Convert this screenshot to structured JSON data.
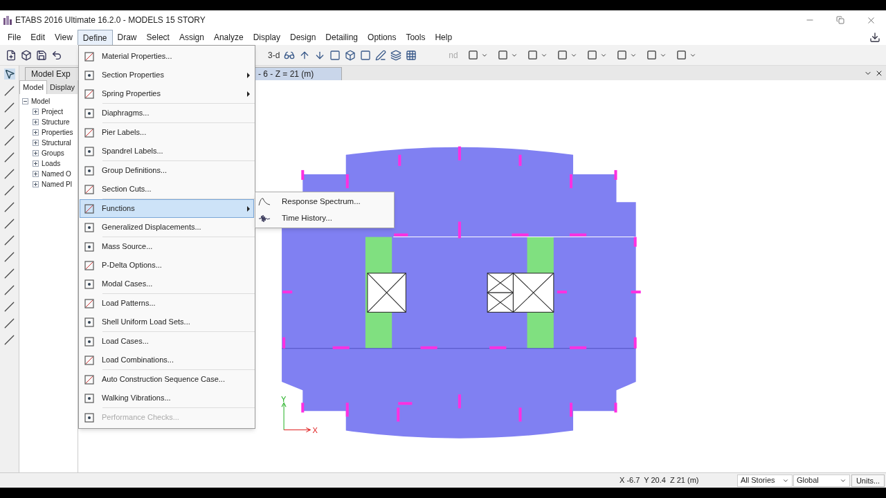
{
  "window": {
    "title": "ETABS 2016 Ultimate 16.2.0 - MODELS 15 STORY"
  },
  "menubar": [
    {
      "label": "File",
      "selected": false
    },
    {
      "label": "Edit",
      "selected": false
    },
    {
      "label": "View",
      "selected": false
    },
    {
      "label": "Define",
      "selected": true
    },
    {
      "label": "Draw",
      "selected": false
    },
    {
      "label": "Select",
      "selected": false
    },
    {
      "label": "Assign",
      "selected": false
    },
    {
      "label": "Analyze",
      "selected": false
    },
    {
      "label": "Display",
      "selected": false
    },
    {
      "label": "Design",
      "selected": false
    },
    {
      "label": "Detailing",
      "selected": false
    },
    {
      "label": "Options",
      "selected": false
    },
    {
      "label": "Tools",
      "selected": false
    },
    {
      "label": "Help",
      "selected": false
    }
  ],
  "toolbar_texts": [
    "3-d",
    "nd"
  ],
  "doc_tabs": [
    {
      "label": "Model Exp",
      "selected": false
    },
    {
      "label": "- 6 - Z = 21 (m)",
      "selected": true
    }
  ],
  "explorer": {
    "tabs": [
      {
        "label": "Model",
        "selected": true
      },
      {
        "label": "Display",
        "selected": false
      }
    ],
    "tree": [
      {
        "label": "Model",
        "expanded": true,
        "children": [
          {
            "label": "Project",
            "expanded": false
          },
          {
            "label": "Structure",
            "expanded": false
          },
          {
            "label": "Properties",
            "expanded": false
          },
          {
            "label": "Structural",
            "expanded": false
          },
          {
            "label": "Groups",
            "expanded": false
          },
          {
            "label": "Loads",
            "expanded": false
          },
          {
            "label": "Named O",
            "expanded": false
          },
          {
            "label": "Named Pl",
            "expanded": false
          }
        ]
      }
    ]
  },
  "define_menu": [
    [
      {
        "label": "Material Properties...",
        "submenu": false,
        "selected": false,
        "disabled": false
      },
      {
        "label": "Section Properties",
        "submenu": true,
        "selected": false,
        "disabled": false
      },
      {
        "label": "Spring Properties",
        "submenu": true,
        "selected": false,
        "disabled": false
      }
    ],
    [
      {
        "label": "Diaphragms...",
        "submenu": false,
        "selected": false,
        "disabled": false
      }
    ],
    [
      {
        "label": "Pier Labels...",
        "submenu": false,
        "selected": false,
        "disabled": false
      },
      {
        "label": "Spandrel Labels...",
        "submenu": false,
        "selected": false,
        "disabled": false
      }
    ],
    [
      {
        "label": "Group Definitions...",
        "submenu": false,
        "selected": false,
        "disabled": false
      },
      {
        "label": "Section Cuts...",
        "submenu": false,
        "selected": false,
        "disabled": false
      }
    ],
    [
      {
        "label": "Functions",
        "submenu": true,
        "selected": true,
        "disabled": false
      },
      {
        "label": "Generalized Displacements...",
        "submenu": false,
        "selected": false,
        "disabled": false
      }
    ],
    [
      {
        "label": "Mass Source...",
        "submenu": false,
        "selected": false,
        "disabled": false
      },
      {
        "label": "P-Delta Options...",
        "submenu": false,
        "selected": false,
        "disabled": false
      },
      {
        "label": "Modal Cases...",
        "submenu": false,
        "selected": false,
        "disabled": false
      }
    ],
    [
      {
        "label": "Load Patterns...",
        "submenu": false,
        "selected": false,
        "disabled": false
      },
      {
        "label": "Shell Uniform Load Sets...",
        "submenu": false,
        "selected": false,
        "disabled": false
      }
    ],
    [
      {
        "label": "Load Cases...",
        "submenu": false,
        "selected": false,
        "disabled": false
      },
      {
        "label": "Load Combinations...",
        "submenu": false,
        "selected": false,
        "disabled": false
      }
    ],
    [
      {
        "label": "Auto Construction Sequence Case...",
        "submenu": false,
        "selected": false,
        "disabled": false
      },
      {
        "label": "Walking Vibrations...",
        "submenu": false,
        "selected": false,
        "disabled": false
      }
    ],
    [
      {
        "label": "Performance Checks...",
        "submenu": false,
        "selected": false,
        "disabled": true
      }
    ]
  ],
  "functions_submenu": [
    {
      "label": "Response Spectrum..."
    },
    {
      "label": "Time History..."
    }
  ],
  "plan": {
    "y_axis": "Y",
    "x_axis": "X"
  },
  "status_bar": {
    "coordinates": "X -6.7  Y 20.4  Z 21 (m)",
    "stories": "All Stories",
    "system": "Global",
    "units": "Units..."
  }
}
